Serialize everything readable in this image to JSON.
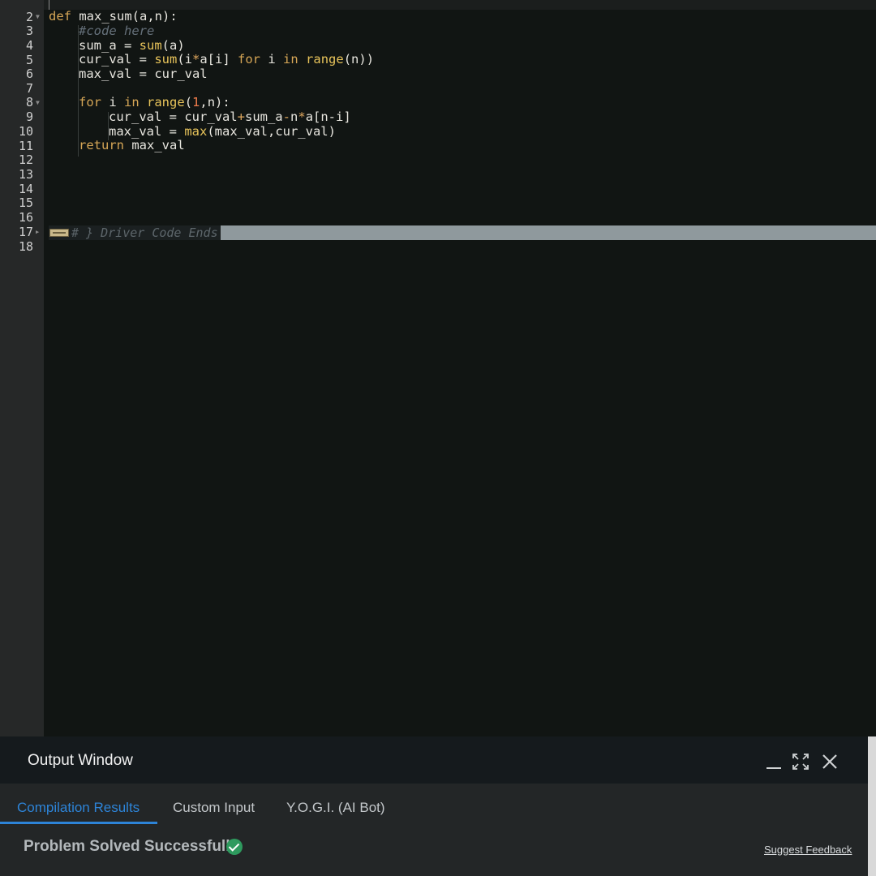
{
  "editor": {
    "lines": [
      {
        "n": "2",
        "fold": false
      },
      {
        "n": "3",
        "fold": true
      },
      {
        "n": "4",
        "fold": false
      },
      {
        "n": "5",
        "fold": false
      },
      {
        "n": "6",
        "fold": false
      },
      {
        "n": "7",
        "fold": false
      },
      {
        "n": "8",
        "fold": false
      },
      {
        "n": "9",
        "fold": true
      },
      {
        "n": "10",
        "fold": false
      },
      {
        "n": "11",
        "fold": false
      },
      {
        "n": "12",
        "fold": false
      },
      {
        "n": "13",
        "fold": false
      },
      {
        "n": "14",
        "fold": false
      },
      {
        "n": "15",
        "fold": false
      },
      {
        "n": "16",
        "fold": false
      },
      {
        "n": "17",
        "fold": false
      },
      {
        "n": "18",
        "fold": "collapsed"
      }
    ],
    "code": {
      "l3_kw": "def",
      "l3_rest": " max_sum(a,n):",
      "l4": "#code here",
      "l5_a": "sum_a = ",
      "l5_fn": "sum",
      "l5_b": "(a)",
      "l6_a": "cur_val = ",
      "l6_fn": "sum",
      "l6_b": "(i",
      "l6_op": "*",
      "l6_c": "a[i] ",
      "l6_kw1": "for",
      "l6_d": " i ",
      "l6_kw2": "in",
      "l6_e": " ",
      "l6_fn2": "range",
      "l6_f": "(n))",
      "l7": "max_val = cur_val",
      "l9_kw1": "for",
      "l9_a": " i ",
      "l9_kw2": "in",
      "l9_b": " ",
      "l9_fn": "range",
      "l9_c": "(",
      "l9_num": "1",
      "l9_d": ",n):",
      "l10_a": "cur_val = cur_val",
      "l10_op1": "+",
      "l10_b": "sum_a",
      "l10_op2": "-",
      "l10_c": "n",
      "l10_op3": "*",
      "l10_d": "a[n-i]",
      "l11_a": "max_val = ",
      "l11_fn": "max",
      "l11_b": "(max_val,cur_val)",
      "l12_kw": "return",
      "l12_b": " max_val",
      "l18_folded": "# } Driver Code Ends"
    }
  },
  "output": {
    "title": "Output Window",
    "icons": [
      "minimize-icon",
      "expand-icon",
      "close-icon"
    ],
    "tabs": [
      {
        "label": "Compilation Results",
        "active": true
      },
      {
        "label": "Custom Input",
        "active": false
      },
      {
        "label": "Y.O.G.I. (AI Bot)",
        "active": false
      }
    ],
    "status": "Problem Solved Successfully",
    "feedback_link": "Suggest Feedback",
    "colors": {
      "accent": "#2d84d8",
      "success": "#2e9a5e"
    }
  }
}
